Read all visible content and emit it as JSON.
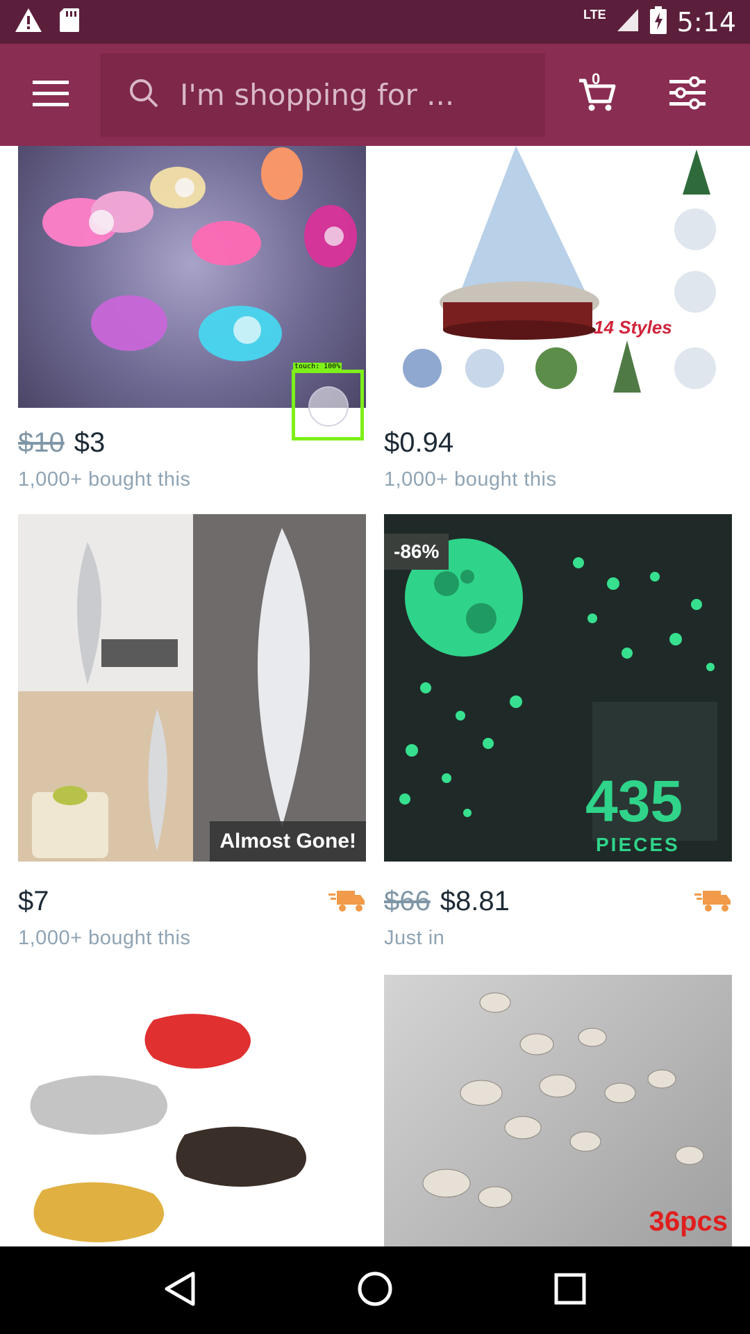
{
  "status_bar": {
    "time": "5:14",
    "network": "LTE"
  },
  "search": {
    "placeholder": "I'm shopping for ..."
  },
  "cart": {
    "count": "0"
  },
  "touch_indicator": {
    "label": "touch: 100%"
  },
  "products": [
    {
      "old_price": "$10",
      "price": "$3",
      "sold": "1,000+ bought this"
    },
    {
      "old_price": "",
      "price": "$0.94",
      "sold": "1,000+ bought this",
      "image_text": "14 Styles"
    },
    {
      "old_price": "",
      "price": "$7",
      "sold": "1,000+ bought this",
      "badge": "Almost Gone!",
      "shipping_icon": "truck-icon"
    },
    {
      "old_price": "$66",
      "price": "$8.81",
      "sold": "Just in",
      "discount": "-86%",
      "image_text": "435",
      "image_text2": "PIECES",
      "shipping_icon": "truck-icon"
    },
    {
      "image_text": ""
    },
    {
      "image_text": "36pcs"
    }
  ],
  "colors": {
    "status_bar": "#5c1f3b",
    "app_bar": "#8a2d52",
    "search_bg": "#7d2749",
    "truck": "#f09a4a",
    "touch_box": "#7ef01a"
  }
}
